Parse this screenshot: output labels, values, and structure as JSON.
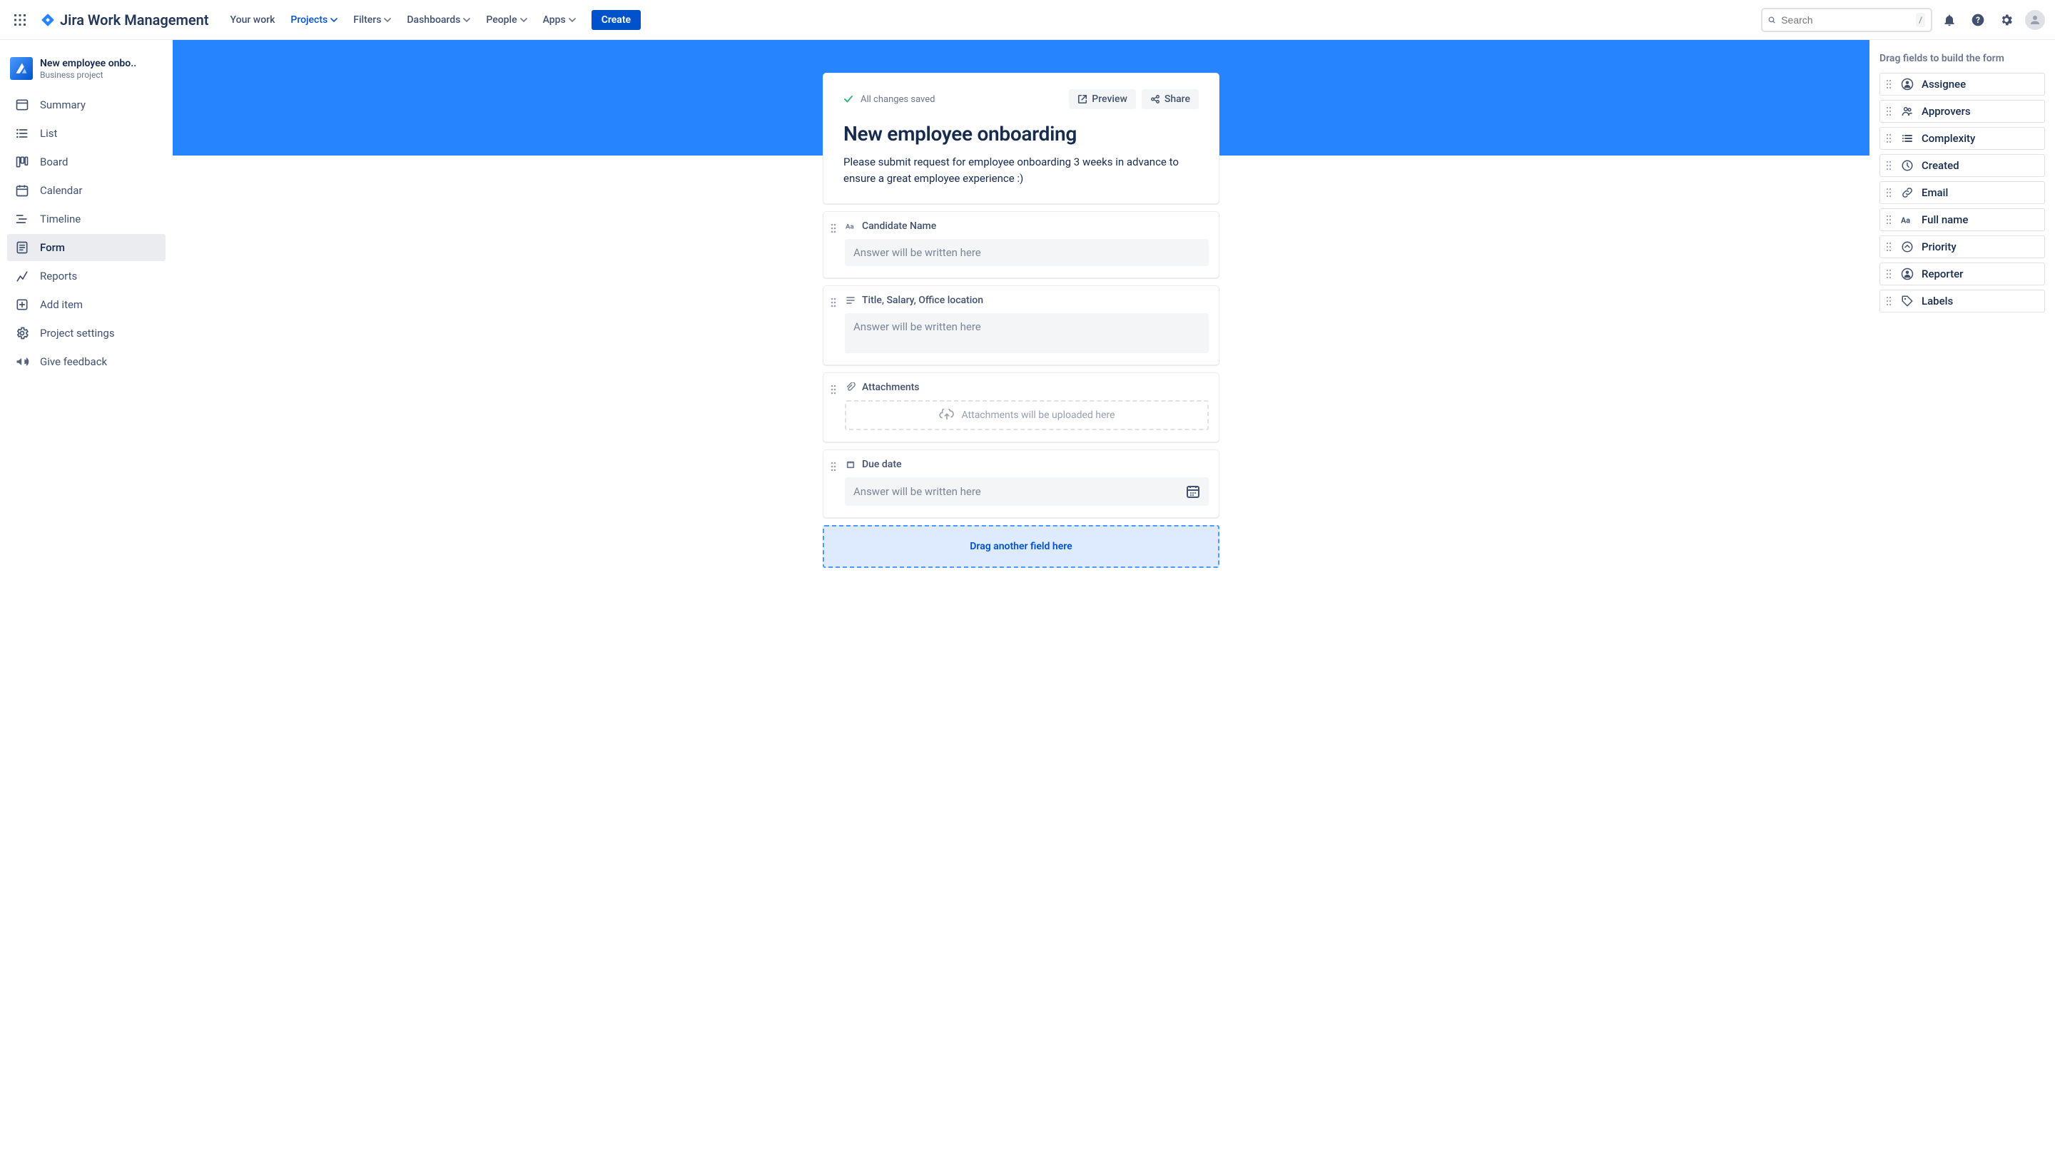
{
  "product": "Jira Work Management",
  "nav": {
    "your_work": "Your work",
    "projects": "Projects",
    "filters": "Filters",
    "dashboards": "Dashboards",
    "people": "People",
    "apps": "Apps",
    "create": "Create"
  },
  "search": {
    "placeholder": "Search",
    "hotkey": "/"
  },
  "project": {
    "name": "New employee onbo..",
    "type": "Business project"
  },
  "sidebar": {
    "summary": "Summary",
    "list": "List",
    "board": "Board",
    "calendar": "Calendar",
    "timeline": "Timeline",
    "form": "Form",
    "reports": "Reports",
    "add_item": "Add item",
    "project_settings": "Project settings",
    "give_feedback": "Give feedback"
  },
  "form_builder": {
    "saved_status": "All changes saved",
    "preview": "Preview",
    "share": "Share",
    "title": "New employee onboarding",
    "description": "Please submit request for employee onboarding 3 weeks in advance to ensure a great employee experience :)",
    "answer_placeholder": "Answer will be written here",
    "attachments_placeholder": "Attachments will be uploaded here",
    "dropzone": "Drag another field here",
    "fields": {
      "candidate_name": "Candidate Name",
      "title_salary": "Title, Salary, Office location",
      "attachments": "Attachments",
      "due_date": "Due date"
    }
  },
  "right_panel": {
    "title": "Drag fields to build the form",
    "items": {
      "assignee": "Assignee",
      "approvers": "Approvers",
      "complexity": "Complexity",
      "created": "Created",
      "email": "Email",
      "full_name": "Full name",
      "priority": "Priority",
      "reporter": "Reporter",
      "labels": "Labels"
    }
  }
}
